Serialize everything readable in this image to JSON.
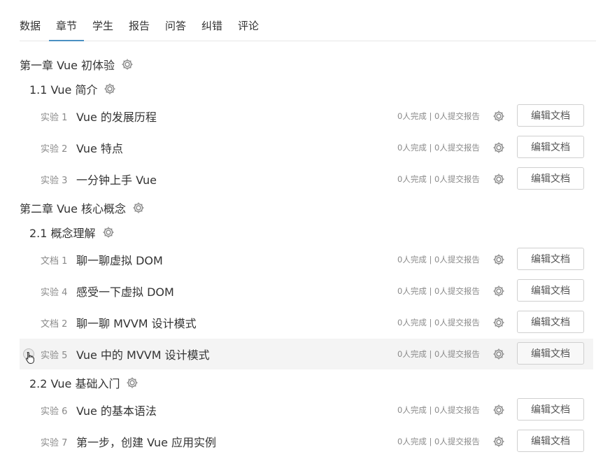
{
  "tabs": [
    "数据",
    "章节",
    "学生",
    "报告",
    "问答",
    "纠错",
    "评论"
  ],
  "active_tab": "章节",
  "chapters": [
    {
      "label": "第一章 Vue 初体验",
      "sections": [
        {
          "label": "1.1 Vue 简介",
          "items": [
            {
              "kind": "实验 1",
              "title": "Vue 的发展历程",
              "stats": "0人完成 | 0人提交报告",
              "button": "编辑文档"
            },
            {
              "kind": "实验 2",
              "title": "Vue 特点",
              "stats": "0人完成 | 0人提交报告",
              "button": "编辑文档"
            },
            {
              "kind": "实验 3",
              "title": "一分钟上手 Vue",
              "stats": "0人完成 | 0人提交报告",
              "button": "编辑文档"
            }
          ]
        }
      ]
    },
    {
      "label": "第二章 Vue 核心概念",
      "sections": [
        {
          "label": "2.1 概念理解",
          "items": [
            {
              "kind": "文档 1",
              "title": "聊一聊虚拟 DOM",
              "stats": "0人完成 | 0人提交报告",
              "button": "编辑文档"
            },
            {
              "kind": "实验 4",
              "title": "感受一下虚拟 DOM",
              "stats": "0人完成 | 0人提交报告",
              "button": "编辑文档"
            },
            {
              "kind": "文档 2",
              "title": "聊一聊 MVVM 设计模式",
              "stats": "0人完成 | 0人提交报告",
              "button": "编辑文档"
            },
            {
              "kind": "实验 5",
              "title": "Vue 中的 MVVM 设计模式",
              "stats": "0人完成 | 0人提交报告",
              "button": "编辑文档",
              "hovered": true
            }
          ]
        },
        {
          "label": "2.2 Vue 基础入门",
          "items": [
            {
              "kind": "实验 6",
              "title": "Vue 的基本语法",
              "stats": "0人完成 | 0人提交报告",
              "button": "编辑文档"
            },
            {
              "kind": "实验 7",
              "title": "第一步，创建 Vue 应用实例",
              "stats": "0人完成 | 0人提交报告",
              "button": "编辑文档"
            }
          ]
        }
      ]
    }
  ],
  "icons": {
    "settings": "gear-icon",
    "drag": "drag-handle-icon",
    "cursor": "hand-cursor-icon"
  },
  "colors": {
    "accent": "#4a90c2",
    "muted": "#8a8a8a",
    "hover_row": "#f4f4f4"
  }
}
